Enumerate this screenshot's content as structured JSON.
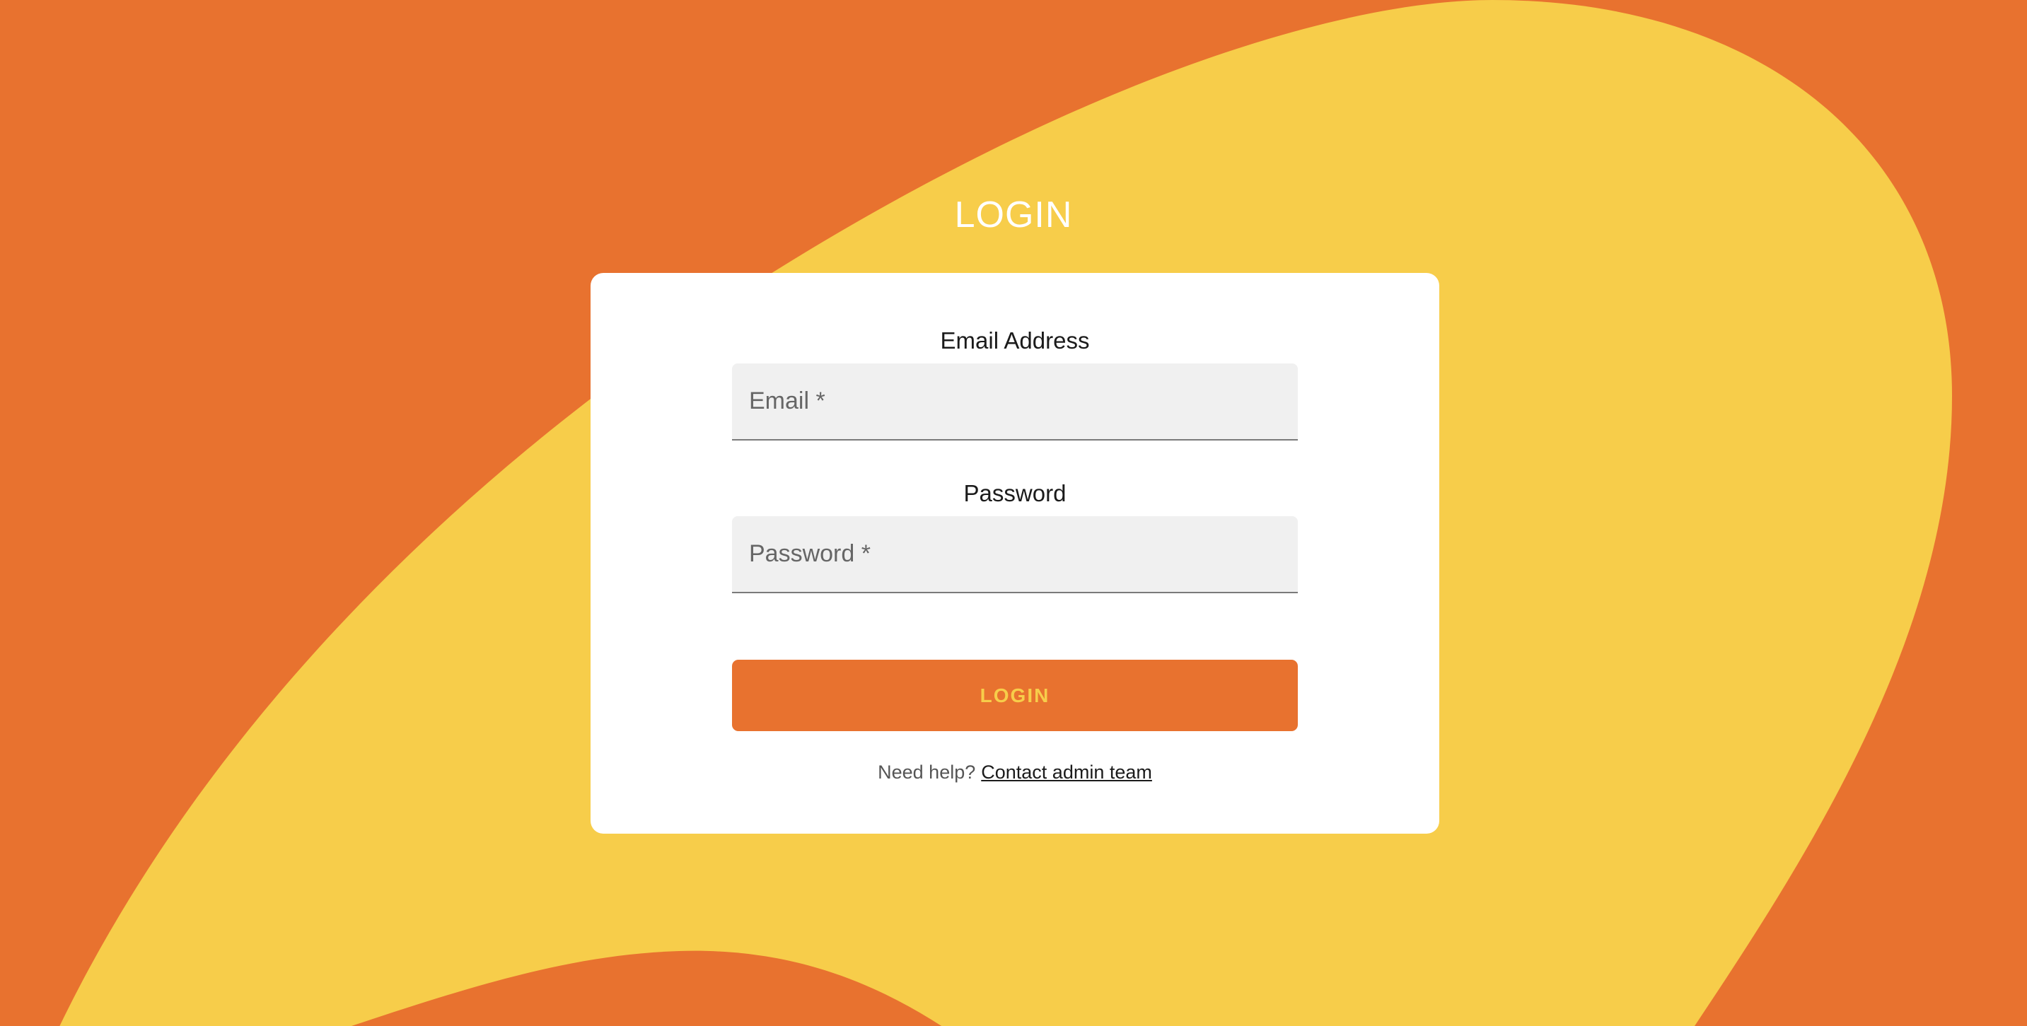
{
  "colors": {
    "background": "#E8722F",
    "blob": "#F7CD4A",
    "card": "#FFFFFF",
    "button": "#E8722F",
    "button_text": "#F7CD4A",
    "input_fill": "#F0F0F0"
  },
  "header": {
    "title": "LOGIN"
  },
  "form": {
    "email_label": "Email Address",
    "email_placeholder": "Email *",
    "email_value": "",
    "password_label": "Password",
    "password_placeholder": "Password *",
    "password_value": "",
    "submit_label": "LOGIN"
  },
  "help": {
    "text": "Need help?",
    "link_label": "Contact admin team"
  }
}
